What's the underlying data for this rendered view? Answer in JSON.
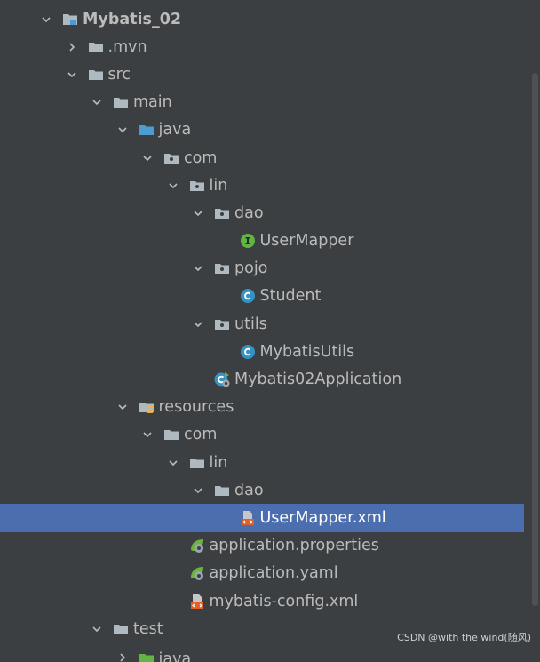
{
  "tree": [
    {
      "label": "Mybatis_02",
      "depth": 0,
      "chevron": "down",
      "icon": "module-folder",
      "bold": true
    },
    {
      "label": ".mvn",
      "depth": 1,
      "chevron": "right",
      "icon": "folder"
    },
    {
      "label": "src",
      "depth": 1,
      "chevron": "down",
      "icon": "folder"
    },
    {
      "label": "main",
      "depth": 2,
      "chevron": "down",
      "icon": "folder"
    },
    {
      "label": "java",
      "depth": 3,
      "chevron": "down",
      "icon": "source-folder"
    },
    {
      "label": "com",
      "depth": 4,
      "chevron": "down",
      "icon": "package"
    },
    {
      "label": "lin",
      "depth": 5,
      "chevron": "down",
      "icon": "package"
    },
    {
      "label": "dao",
      "depth": 6,
      "chevron": "down",
      "icon": "package"
    },
    {
      "label": "UserMapper",
      "depth": 7,
      "chevron": "none",
      "icon": "interface"
    },
    {
      "label": "pojo",
      "depth": 6,
      "chevron": "down",
      "icon": "package"
    },
    {
      "label": "Student",
      "depth": 7,
      "chevron": "none",
      "icon": "class"
    },
    {
      "label": "utils",
      "depth": 6,
      "chevron": "down",
      "icon": "package"
    },
    {
      "label": "MybatisUtils",
      "depth": 7,
      "chevron": "none",
      "icon": "class"
    },
    {
      "label": "Mybatis02Application",
      "depth": 6,
      "chevron": "none",
      "icon": "spring-boot-class"
    },
    {
      "label": "resources",
      "depth": 3,
      "chevron": "down",
      "icon": "resources-folder"
    },
    {
      "label": "com",
      "depth": 4,
      "chevron": "down",
      "icon": "folder"
    },
    {
      "label": "lin",
      "depth": 5,
      "chevron": "down",
      "icon": "folder"
    },
    {
      "label": "dao",
      "depth": 6,
      "chevron": "down",
      "icon": "folder"
    },
    {
      "label": "UserMapper.xml",
      "depth": 7,
      "chevron": "none",
      "icon": "xml-file",
      "selected": true
    },
    {
      "label": "application.properties",
      "depth": 5,
      "chevron": "none",
      "icon": "spring-config"
    },
    {
      "label": "application.yaml",
      "depth": 5,
      "chevron": "none",
      "icon": "spring-config"
    },
    {
      "label": "mybatis-config.xml",
      "depth": 5,
      "chevron": "none",
      "icon": "xml-file"
    },
    {
      "label": "test",
      "depth": 2,
      "chevron": "down",
      "icon": "folder"
    },
    {
      "label": "java",
      "depth": 3,
      "chevron": "right",
      "icon": "test-folder",
      "cut": true
    }
  ],
  "colors": {
    "background": "#3c3f41",
    "selected": "#4b6eaf",
    "text": "#bbbbbb",
    "folder": "#aeb9c0",
    "source_folder": "#4c9bd1",
    "test_folder": "#62b543",
    "interface": "#62b543",
    "class": "#3592c4",
    "spring": "#6db33f",
    "xml": "#e2602a"
  },
  "watermark": "CSDN @with the wind(随风)"
}
